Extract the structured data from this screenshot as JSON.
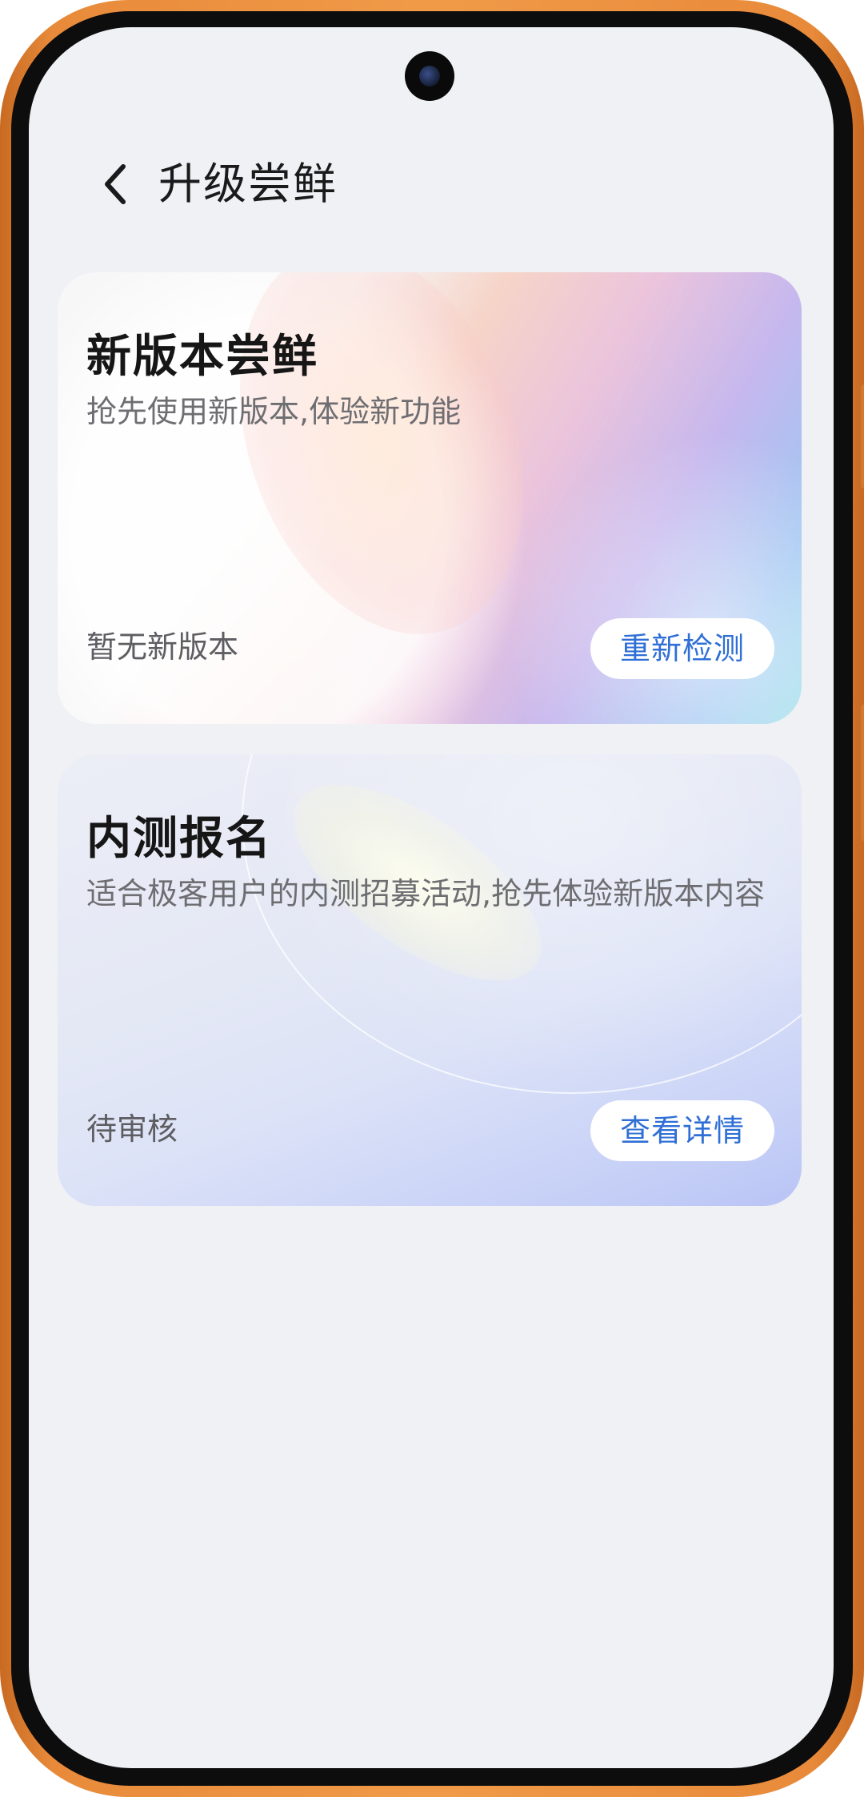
{
  "header": {
    "title": "升级尝鲜",
    "back_icon": "chevron-left-icon"
  },
  "cards": [
    {
      "title": "新版本尝鲜",
      "description": "抢先使用新版本,体验新功能",
      "status": "暂无新版本",
      "button_label": "重新检测"
    },
    {
      "title": "内测报名",
      "description": "适合极客用户的内测招募活动,抢先体验新版本内容",
      "status": "待审核",
      "button_label": "查看详情"
    }
  ],
  "colors": {
    "accent": "#2f6fd6",
    "background": "#eff1f5",
    "frame": "#f09a48"
  }
}
